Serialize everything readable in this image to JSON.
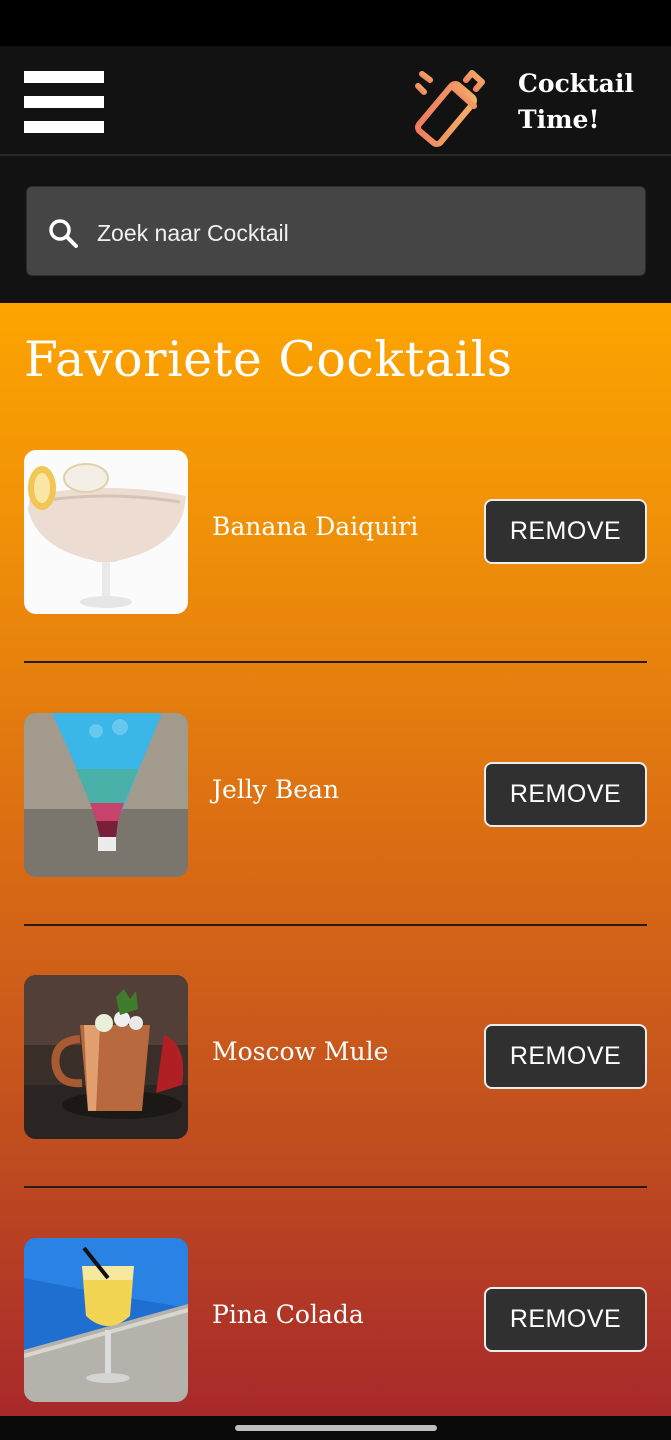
{
  "app": {
    "title": "Cocktail Time!",
    "title_line1": "Cocktail",
    "title_line2": "Time!",
    "logo_icon": "cocktail-shaker-icon",
    "menu_icon": "hamburger-menu-icon"
  },
  "search": {
    "placeholder": "Zoek naar Cocktail",
    "value": "",
    "icon": "search-icon"
  },
  "page": {
    "title": "Favoriete Cocktails"
  },
  "favorites": [
    {
      "name": "Banana Daiquiri",
      "remove_label": "REMOVE"
    },
    {
      "name": "Jelly Bean",
      "remove_label": "REMOVE"
    },
    {
      "name": "Moscow Mule",
      "remove_label": "REMOVE"
    },
    {
      "name": "Pina Colada",
      "remove_label": "REMOVE"
    }
  ],
  "colors": {
    "app_bar": "#121212",
    "search_field": "#454545",
    "gradient_top": "#fda400",
    "gradient_bottom": "#a8282a",
    "logo_accent": "#f08a5d",
    "button_bg": "#303030"
  }
}
